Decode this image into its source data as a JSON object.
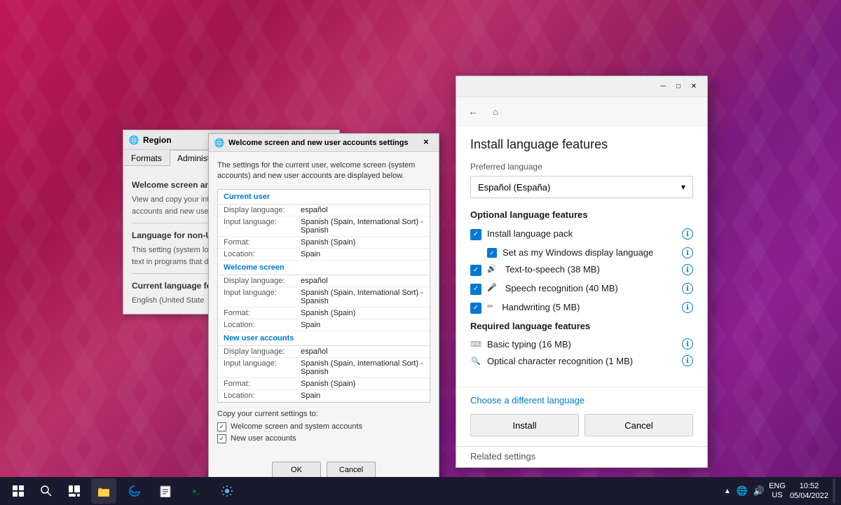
{
  "desktop": {
    "taskbar": {
      "start_icon": "⊞",
      "search_icon": "🔍",
      "apps": [
        "📁",
        "🌐",
        "📋",
        "🖥"
      ],
      "right_icons": [
        "▲",
        "🔊",
        "🌐"
      ],
      "lang": "ENG",
      "region": "US",
      "time": "10:52",
      "date": "05/04/2022"
    }
  },
  "region_window": {
    "title": "Region",
    "tabs": [
      "Formats",
      "Administrative"
    ],
    "active_tab": "Administrative",
    "section1_title": "Welcome screen and new user accounts",
    "section1_text": "View and copy your inte",
    "section1_text2": "accounts and new user a",
    "section2_title": "Language for non-Unico",
    "section2_text": "This setting (system loc",
    "section2_text2": "text in programs that do",
    "section3_title": "Current language for no",
    "section3_value": "English (United State"
  },
  "welcome_dialog": {
    "title": "Welcome screen and new user accounts settings",
    "close_label": "✕",
    "description": "The settings for the current user, welcome screen (system accounts) and new user accounts are displayed below.",
    "current_user_header": "Current user",
    "current_user": {
      "display_language_label": "Display language:",
      "display_language_value": "español",
      "input_language_label": "Input language:",
      "input_language_value": "Spanish (Spain, International Sort) - Spanish",
      "format_label": "Format:",
      "format_value": "Spanish (Spain)",
      "location_label": "Location:",
      "location_value": "Spain"
    },
    "welcome_screen_header": "Welcome screen",
    "welcome_screen": {
      "display_language_label": "Display language:",
      "display_language_value": "español",
      "input_language_label": "Input language:",
      "input_language_value": "Spanish (Spain, International Sort) - Spanish",
      "format_label": "Format:",
      "format_value": "Spanish (Spain)",
      "location_label": "Location:",
      "location_value": "Spain"
    },
    "new_user_header": "New user accounts",
    "new_user": {
      "display_language_label": "Display language:",
      "display_language_value": "español",
      "input_language_label": "Input language:",
      "input_language_value": "Spanish (Spain, International Sort) - Spanish",
      "format_label": "Format:",
      "format_value": "Spanish (Spain)",
      "location_label": "Location:",
      "location_value": "Spain"
    },
    "copy_title": "Copy your current settings to:",
    "checkbox1_label": "Welcome screen and system accounts",
    "checkbox1_checked": true,
    "checkbox2_label": "New user accounts",
    "checkbox2_checked": true,
    "ok_btn": "OK",
    "cancel_btn": "Cancel"
  },
  "install_panel": {
    "title_bar": {
      "back_icon": "←",
      "home_icon": "⌂",
      "minimize_icon": "─",
      "maximize_icon": "□",
      "close_icon": "✕"
    },
    "title": "Install language features",
    "preferred_language_label": "Preferred language",
    "language_selected": "Español (España)",
    "optional_section": "Optional language features",
    "install_language_pack_label": "Install language pack",
    "set_display_label": "Set as my Windows display language",
    "tts_label": "Text-to-speech (38 MB)",
    "speech_recognition_label": "Speech recognition (40 MB)",
    "handwriting_label": "Handwriting (5 MB)",
    "required_section": "Required language features",
    "basic_typing_label": "Basic typing (16 MB)",
    "ocr_label": "Optical character recognition (1 MB)",
    "choose_different_lang": "Choose a different language",
    "install_btn": "Install",
    "cancel_btn": "Cancel",
    "related_settings": "Related settings"
  }
}
